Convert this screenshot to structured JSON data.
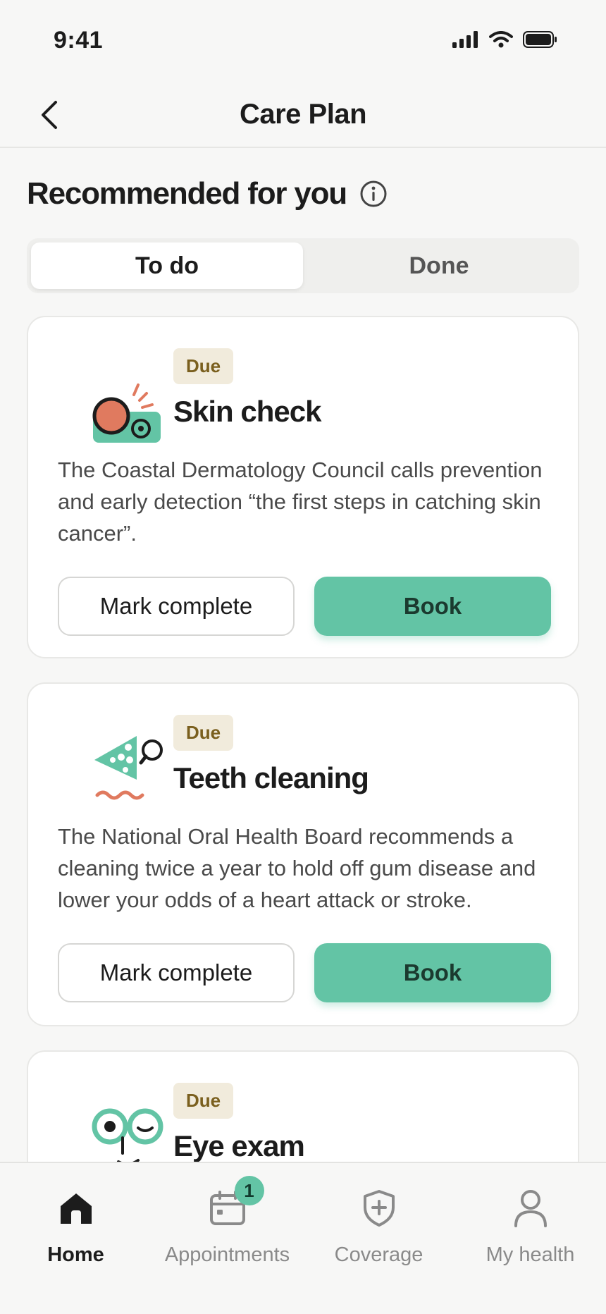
{
  "status_bar": {
    "time": "9:41"
  },
  "nav": {
    "title": "Care Plan"
  },
  "section": {
    "title": "Recommended for you"
  },
  "segments": [
    {
      "label": "To do",
      "active": true
    },
    {
      "label": "Done",
      "active": false
    }
  ],
  "cards": [
    {
      "badge": "Due",
      "title": "Skin check",
      "description": "The Coastal Dermatology Council calls prevention and early detection “the first steps in catching skin cancer”.",
      "secondary_label": "Mark complete",
      "primary_label": "Book"
    },
    {
      "badge": "Due",
      "title": "Teeth cleaning",
      "description": "The National Oral Health Board recommends a cleaning twice a year to hold off gum disease and lower your odds of a heart attack or stroke.",
      "secondary_label": "Mark complete",
      "primary_label": "Book"
    },
    {
      "badge": "Due",
      "title": "Eye exam"
    }
  ],
  "tab_bar": {
    "items": [
      {
        "label": "Home",
        "icon": "home-icon",
        "active": true
      },
      {
        "label": "Appointments",
        "icon": "calendar-icon",
        "badge": "1"
      },
      {
        "label": "Coverage",
        "icon": "shield-plus-icon"
      },
      {
        "label": "My health",
        "icon": "person-icon"
      }
    ]
  },
  "colors": {
    "accent": "#63c4a5",
    "badge_bg": "#f1ebdc",
    "badge_text": "#7a5f1e",
    "coral": "#e07a5f"
  }
}
